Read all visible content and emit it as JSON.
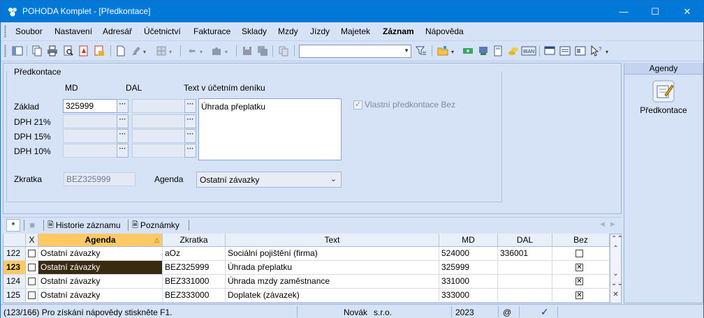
{
  "window": {
    "title": "POHODA Komplet - [Předkontace]"
  },
  "menu": [
    "Soubor",
    "Nastavení",
    "Adresář",
    "Účetnictví",
    "Fakturace",
    "Sklady",
    "Mzdy",
    "Jízdy",
    "Majetek",
    "Záznam",
    "Nápověda"
  ],
  "form": {
    "section_title": "Předkontace",
    "col_md": "MD",
    "col_dal": "DAL",
    "col_text": "Text v účetním deníku",
    "rows": [
      "Základ",
      "DPH 21%",
      "DPH 15%",
      "DPH 10%"
    ],
    "zaklad_md": "325999",
    "text_value": "Úhrada přeplatku",
    "vlastni_label": "Vlastní předkontace Bez",
    "zkratka_label": "Zkratka",
    "zkratka_value": "BEZ325999",
    "agenda_label": "Agenda",
    "agenda_value": "Ostatní závazky"
  },
  "agendy": {
    "header": "Agendy",
    "item": "Předkontace"
  },
  "tabs": {
    "star": "*",
    "historie": "Historie záznamu",
    "poznamky": "Poznámky"
  },
  "grid": {
    "headers": {
      "x": "X",
      "agenda": "Agenda",
      "zkratka": "Zkratka",
      "text": "Text",
      "md": "MD",
      "dal": "DAL",
      "bez": "Bez"
    },
    "rows": [
      {
        "num": "122",
        "agenda": "Ostatní závazky",
        "zkratka": "aOz",
        "text": "Sociální pojištění (firma)",
        "md": "524000",
        "dal": "336001",
        "bez": false
      },
      {
        "num": "123",
        "agenda": "Ostatní závazky",
        "zkratka": "BEZ325999",
        "text": "Úhrada přeplatku",
        "md": "325999",
        "dal": "",
        "bez": true
      },
      {
        "num": "124",
        "agenda": "Ostatní závazky",
        "zkratka": "BEZ331000",
        "text": "Úhrada mzdy zaměstnance",
        "md": "331000",
        "dal": "",
        "bez": true
      },
      {
        "num": "125",
        "agenda": "Ostatní závazky",
        "zkratka": "BEZ333000",
        "text": "Doplatek (závazek)",
        "md": "333000",
        "dal": "",
        "bez": true
      }
    ]
  },
  "status": {
    "help": "(123/166) Pro získání nápovědy stiskněte F1.",
    "user": "Novák",
    "company": "s.r.o.",
    "year": "2023",
    "at": "@"
  },
  "colors": {
    "titlebar": "#0078d7",
    "background": "#d6e2f5",
    "accent_header": "#ffc966",
    "selected_cell": "#3a2a0f"
  }
}
